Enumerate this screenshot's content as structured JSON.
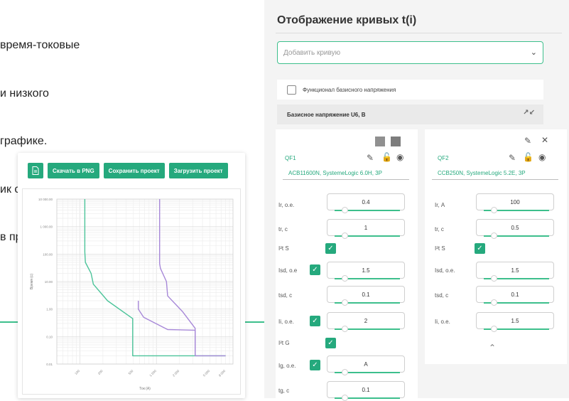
{
  "intro_text": [
    "время-токовые",
    "и низкого",
    "графике.",
    "ик с помощью",
    "в пределах"
  ],
  "chart_card": {
    "buttons": {
      "export_icon": "document-icon",
      "png": "Скачать в PNG",
      "save": "Сохранить проект",
      "load": "Загрузить проект"
    }
  },
  "chart_data": {
    "type": "line",
    "xscale": "log",
    "yscale": "log",
    "xlabel": "Ток (А)",
    "ylabel": "Время (с)",
    "xlim": [
      50,
      10000
    ],
    "ylim": [
      0.01,
      10000
    ],
    "x_ticks": [
      "100",
      "200",
      "500",
      "1 000",
      "2 000",
      "5 000",
      "8 000"
    ],
    "x_tick_values": [
      100,
      200,
      500,
      1000,
      2000,
      5000,
      8000
    ],
    "y_ticks": [
      "10 000.00",
      "1 000.00",
      "100.00",
      "10.00",
      "1.00",
      "0.10",
      "0.01"
    ],
    "y_tick_values": [
      10000,
      1000,
      100,
      10,
      1,
      0.1,
      0.01
    ],
    "grid": true,
    "series": [
      {
        "color": "#4cc49a",
        "x": [
          116,
          116,
          118,
          140,
          150,
          230,
          490,
          490,
          8000
        ],
        "y": [
          10000,
          120,
          50,
          20,
          8,
          2,
          0.45,
          0.02,
          0.02
        ]
      },
      {
        "color": "#a788d8",
        "x": [
          1100,
          1100,
          1130,
          1350,
          1400,
          2200,
          3200,
          3200,
          5000,
          5200,
          8000
        ],
        "y": [
          10000,
          45,
          30,
          10,
          3,
          0.8,
          0.2,
          0.02,
          0.02,
          0.02,
          0.02
        ]
      },
      {
        "color": "#a788d8",
        "x": [
          580,
          580,
          680,
          1400,
          3200,
          3200
        ],
        "y": [
          2,
          1,
          0.5,
          0.18,
          0.17,
          0.02
        ]
      }
    ]
  },
  "panel": {
    "title": "Отображение кривых t(i)",
    "select_placeholder": "Добавить кривую",
    "func_label": "Функционал базисного напряжения",
    "base_voltage_label": "Базисное напряжение U6, В",
    "qf1": {
      "name": "QF1",
      "model": "ACB11600N, SystemeLogic 6.0H, 3P",
      "rows": [
        {
          "label": "Ir, о.е.",
          "value": "0.4"
        },
        {
          "label": "tr, с",
          "value": "1"
        },
        {
          "label": "I²t S",
          "checkbox": true
        },
        {
          "label": "Isd, о.е",
          "value": "1.5",
          "checkbox": true
        },
        {
          "label": "tsd, с",
          "value": "0.1"
        },
        {
          "label": "Ii, о.е.",
          "value": "2",
          "checkbox": true
        },
        {
          "label": "I²t G",
          "checkbox": true
        },
        {
          "label": "Ig, о.е.",
          "value": "A",
          "checkbox": true
        },
        {
          "label": "tg, с",
          "value": "0.1"
        }
      ]
    },
    "qf2": {
      "name": "QF2",
      "model": "CCB250N, SystemeLogic 5.2E, 3P",
      "rows": [
        {
          "label": "Ir, А",
          "value": "100"
        },
        {
          "label": "tr, с",
          "value": "0.5"
        },
        {
          "label": "I²t S",
          "checkbox": true
        },
        {
          "label": "Isd, о.е.",
          "value": "1.5"
        },
        {
          "label": "tsd, с",
          "value": "0.1"
        },
        {
          "label": "Ii, о.е.",
          "value": "1.5"
        }
      ]
    },
    "colors": {
      "accent": "#25a97d",
      "curve1": "#4cc49a",
      "curve2": "#a788d8"
    }
  }
}
